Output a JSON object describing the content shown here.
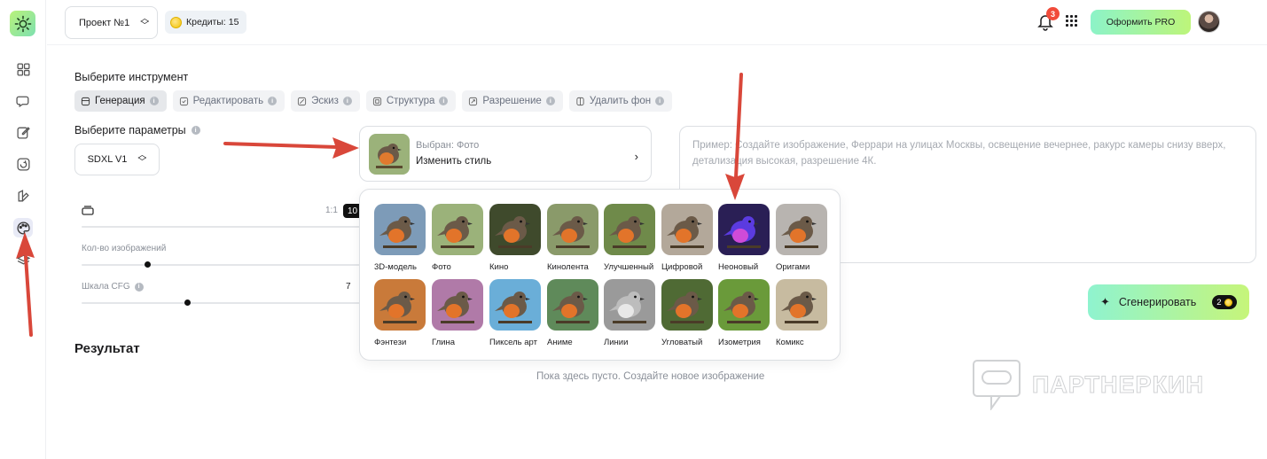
{
  "topbar": {
    "project_label": "Проект №1",
    "credits_label": "Кредиты: 15",
    "notifications_count": "3",
    "pro_button": "Оформить PRO"
  },
  "tools": {
    "heading": "Выберите инструмент",
    "items": [
      {
        "label": "Генерация",
        "icon": "cube-icon",
        "active": true
      },
      {
        "label": "Редактировать",
        "icon": "edit-check-icon",
        "active": false
      },
      {
        "label": "Эскиз",
        "icon": "sketch-icon",
        "active": false
      },
      {
        "label": "Структура",
        "icon": "structure-icon",
        "active": false
      },
      {
        "label": "Разрешение",
        "icon": "resolution-icon",
        "active": false
      },
      {
        "label": "Удалить фон",
        "icon": "remove-bg-icon",
        "active": false
      }
    ]
  },
  "params": {
    "heading": "Выберите параметры",
    "model": "SDXL V1",
    "aspect_label": "1:1",
    "aspect_value": "10",
    "count_label": "Кол-во изображений",
    "count_value": 0.23,
    "cfg_label": "Шкала CFG",
    "cfg_value": "7"
  },
  "style_selector": {
    "selected_prefix": "Выбран: Фото",
    "change_label": "Изменить стиль"
  },
  "prompt": {
    "placeholder": "Пример: Создайте изображение, Феррари на улицах Москвы, освещение вечернее, ракурс камеры снизу вверх, детализация высокая, разрешение 4К."
  },
  "styles": [
    {
      "name": "3D-модель",
      "bg": "#7d9bb8"
    },
    {
      "name": "Фото",
      "bg": "#9bb27a"
    },
    {
      "name": "Кино",
      "bg": "#3f4a2c"
    },
    {
      "name": "Кинолента",
      "bg": "#8a9a6a"
    },
    {
      "name": "Улучшенный",
      "bg": "#6f8a4a"
    },
    {
      "name": "Цифровой",
      "bg": "#b3a89a"
    },
    {
      "name": "Неоновый",
      "bg": "#2a1f55"
    },
    {
      "name": "Оригами",
      "bg": "#b8b4b0"
    },
    {
      "name": "Фэнтези",
      "bg": "#c97a3a"
    },
    {
      "name": "Глина",
      "bg": "#b07aa8"
    },
    {
      "name": "Пиксель арт",
      "bg": "#6aaed8"
    },
    {
      "name": "Аниме",
      "bg": "#5f8a5a"
    },
    {
      "name": "Линии",
      "bg": "#9a9a9a"
    },
    {
      "name": "Угловатый",
      "bg": "#4f6a34"
    },
    {
      "name": "Изометрия",
      "bg": "#6a9a3a"
    },
    {
      "name": "Комикс",
      "bg": "#c7bba0"
    }
  ],
  "generate": {
    "label": "Сгенерировать",
    "cost": "2"
  },
  "result": {
    "heading": "Результат",
    "empty_text": "Пока здесь пусто. Создайте новое изображение"
  },
  "watermark": {
    "text": "ПАРТНЕРКИН"
  },
  "colors": {
    "accent_green": "#bdf57a",
    "accent_mint": "#8cf3c8",
    "annotation_arrow": "#d9473a"
  }
}
